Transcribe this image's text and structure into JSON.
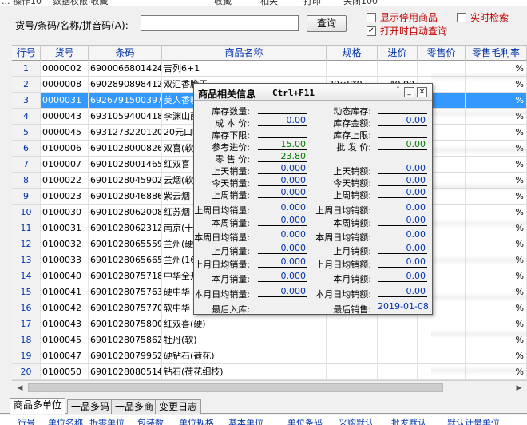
{
  "menu": [
    "... 操作10",
    "数据权限·收藏",
    "收藏",
    "相关",
    "打印",
    "关闭100"
  ],
  "search": {
    "label": "货号/条码/名称/拼音码(A):",
    "value": "",
    "query_label": "查询",
    "options": [
      {
        "label": "显示停用商品",
        "checked": false
      },
      {
        "label": "实时检索",
        "checked": false
      },
      {
        "label": "打开时自动查询",
        "checked": true
      }
    ]
  },
  "grid": {
    "columns": [
      "行号",
      "货号",
      "条码",
      "商品名称",
      "规格",
      "进价",
      "零售价",
      "零售毛利率"
    ],
    "rows": [
      [
        "1",
        "0000002",
        "6900066801424",
        "吉列6+1",
        "",
        "",
        "",
        "%"
      ],
      [
        "2",
        "0000008",
        "6902890898412",
        "双汇香脆王",
        "30×8*9",
        "40.00",
        "",
        "%"
      ],
      [
        "3",
        "0000031",
        "6926791500397",
        "美人香暖",
        "",
        "",
        "",
        "%"
      ],
      [
        "4",
        "0000043",
        "6931059400418",
        "李渊山西白",
        "",
        "",
        "",
        "%"
      ],
      [
        "5",
        "0000045",
        "6931273220120",
        "20元口味王",
        "",
        "",
        "",
        "%"
      ],
      [
        "6",
        "0100006",
        "6901028000826",
        "双喜(软经",
        "",
        "",
        "",
        "%"
      ],
      [
        "7",
        "0100007",
        "6901028001465",
        "红双喜",
        "",
        "",
        "",
        "%"
      ],
      [
        "8",
        "0100022",
        "6901028045902",
        "云烟(软珍",
        "",
        "",
        "",
        "%"
      ],
      [
        "9",
        "0100023",
        "6901028046886",
        "紫云烟",
        "",
        "",
        "",
        "%"
      ],
      [
        "10",
        "0100030",
        "6901028062008",
        "红苏烟",
        "",
        "",
        "",
        "%"
      ],
      [
        "11",
        "0100031",
        "6901028062312",
        "南京(十二",
        "",
        "",
        "",
        "%"
      ],
      [
        "12",
        "0100032",
        "6901028065559",
        "兰州(硬精",
        "",
        "",
        "",
        "%"
      ],
      [
        "13",
        "0100033",
        "6901028065665",
        "兰州(16支",
        "",
        "",
        "",
        "%"
      ],
      [
        "14",
        "0100040",
        "6901028075718",
        "中华全开盒",
        "",
        "",
        "",
        "%"
      ],
      [
        "15",
        "0100041",
        "6901028075763",
        "硬中华",
        "",
        "",
        "",
        "%"
      ],
      [
        "16",
        "0100042",
        "6901028075770",
        "软中华",
        "",
        "",
        "",
        "%"
      ],
      [
        "17",
        "0100043",
        "6901028075800",
        "红双喜(硬)",
        "",
        "",
        "",
        "%"
      ],
      [
        "18",
        "0100045",
        "6901028075862",
        "牡丹(软)",
        "",
        "",
        "",
        "%"
      ],
      [
        "19",
        "0100047",
        "6901028079952",
        "硬钻石(荷花)",
        "",
        "",
        "",
        "%"
      ],
      [
        "20",
        "0100050",
        "6901028080514",
        "钻石(荷花细枝)",
        "",
        "",
        "",
        "%"
      ]
    ]
  },
  "tabs": [
    "商品多单位",
    "一品多码",
    "一品多商",
    "变更日志"
  ],
  "subheader": [
    "行号",
    "单位名称",
    "折零单位",
    "包装数",
    "单位规格",
    "基本单位",
    "单位条码",
    "采购默认",
    "批发默认",
    "默认计量单位"
  ],
  "popup": {
    "title": "商品相关信息",
    "shortcut": "Ctrl+F11",
    "fields": [
      {
        "label": "库存数量:",
        "value": ""
      },
      {
        "label": "动态库存:",
        "value": ""
      },
      {
        "label": "成 本 价:",
        "value": "0.00"
      },
      {
        "label": "库存金额:",
        "value": "0.00"
      },
      {
        "label": "库存下限:",
        "value": ""
      },
      {
        "label": "库存上限:",
        "value": ""
      },
      {
        "label": "参考进价:",
        "value": "15.00"
      },
      {
        "label": "批 发 价:",
        "value": "0.00"
      },
      {
        "label": "零 售 价:",
        "value": "23.80"
      },
      {
        "label": "上天销量:",
        "value": "0.000"
      },
      {
        "label": "上天销额:",
        "value": "0.00"
      },
      {
        "label": "今天销量:",
        "value": "0.000"
      },
      {
        "label": "今天销额:",
        "value": "0.00"
      },
      {
        "label": "上周销量:",
        "value": "0.000"
      },
      {
        "label": "上周销额:",
        "value": "0.00"
      },
      {
        "label": "上周日均销量:",
        "value": "0.000"
      },
      {
        "label": "上周日均销额:",
        "value": "0.00"
      },
      {
        "label": "本周销量:",
        "value": "0.000"
      },
      {
        "label": "本周销额:",
        "value": "0.00"
      },
      {
        "label": "本周日均销量:",
        "value": "0.000"
      },
      {
        "label": "本周日均销额:",
        "value": "0.00"
      },
      {
        "label": "上月销量:",
        "value": "0.000"
      },
      {
        "label": "上月销额:",
        "value": "0.00"
      },
      {
        "label": "上月日均销量:",
        "value": "0.000"
      },
      {
        "label": "上月日均销额:",
        "value": "0.00"
      },
      {
        "label": "本月销量:",
        "value": "0.000"
      },
      {
        "label": "本月销额:",
        "value": "0.00"
      },
      {
        "label": "本月日均销量:",
        "value": "0.000"
      },
      {
        "label": "本月日均销额:",
        "value": "0.00"
      },
      {
        "label": "最后入库:",
        "value": ""
      },
      {
        "label": "最后销售:",
        "value": "2019-01-08"
      }
    ]
  }
}
